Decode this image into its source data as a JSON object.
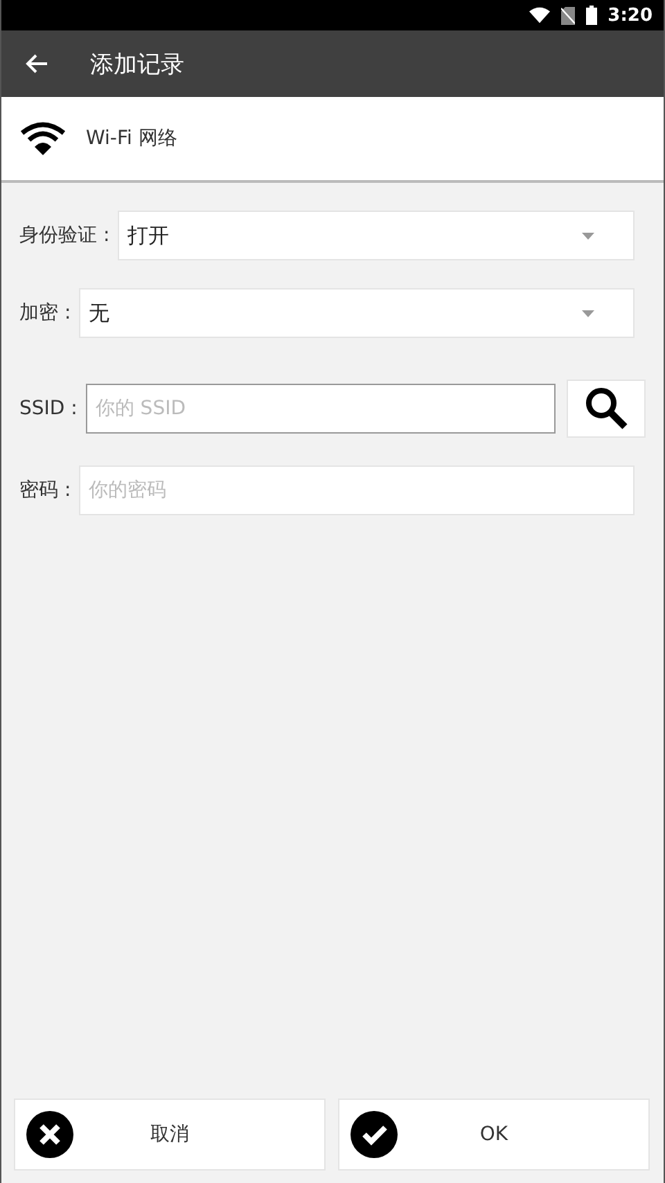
{
  "status_bar": {
    "time": "3:20"
  },
  "app_bar": {
    "title": "添加记录"
  },
  "section": {
    "title": "Wi-Fi 网络"
  },
  "fields": [
    {
      "kind": "dropdown",
      "label": "身份验证 :",
      "value": "打开"
    },
    {
      "kind": "dropdown",
      "label": "加密 :",
      "value": "无"
    },
    {
      "kind": "search-input",
      "label": "SSID :",
      "placeholder": "你的 SSID"
    },
    {
      "kind": "input",
      "label": "密码 :",
      "placeholder": "你的密码"
    }
  ],
  "buttons": [
    {
      "kind": "cancel",
      "label": "取消"
    },
    {
      "kind": "ok",
      "label": "OK"
    }
  ]
}
